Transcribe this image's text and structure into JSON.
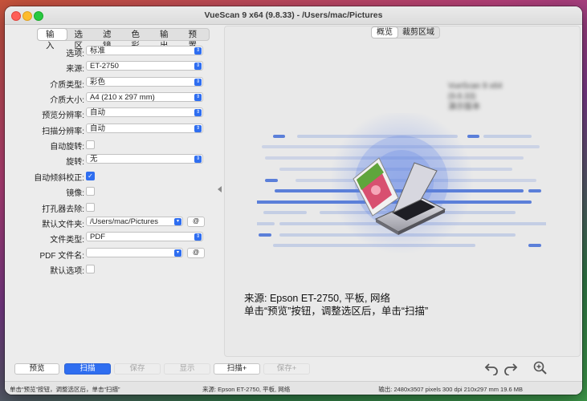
{
  "window": {
    "title": "VueScan 9 x64 (9.8.33) - /Users/mac/Pictures"
  },
  "left_tabs": [
    "输入",
    "选区",
    "滤镜",
    "色彩",
    "输出",
    "预置"
  ],
  "form": {
    "option": {
      "label": "选项:",
      "value": "标准"
    },
    "source": {
      "label": "来源:",
      "value": "ET-2750"
    },
    "media_type": {
      "label": "介质类型:",
      "value": "彩色"
    },
    "media_size": {
      "label": "介质大小:",
      "value": "A4 (210 x 297 mm)"
    },
    "preview_res": {
      "label": "预览分辨率:",
      "value": "自动"
    },
    "scan_res": {
      "label": "扫描分辨率:",
      "value": "自动"
    },
    "auto_rotate": {
      "label": "自动旋转:"
    },
    "rotate": {
      "label": "旋转:",
      "value": "无"
    },
    "auto_deskew": {
      "label": "自动倾斜校正:"
    },
    "mirror": {
      "label": "镜像:"
    },
    "hole_remove": {
      "label": "打孔器去除:"
    },
    "default_folder": {
      "label": "默认文件夹:",
      "value": "/Users/mac/Pictures",
      "at": "@"
    },
    "file_type": {
      "label": "文件类型:",
      "value": "PDF"
    },
    "pdf_name": {
      "label": "PDF 文件名:",
      "value": "",
      "at": "@"
    },
    "default_opts": {
      "label": "默认选项:"
    }
  },
  "right_tabs": [
    "概览",
    "裁剪区域"
  ],
  "overview": {
    "blurred_line1": "VueScan 9 x64 (9.8.33)",
    "blurred_line2": "演示版本",
    "source_info": "来源: Epson ET-2750, 平板, 网络",
    "hint": "单击“预览”按钮，调整选区后，单击“扫描”"
  },
  "buttons": {
    "preview": "预览",
    "scan": "扫描",
    "save": "保存",
    "show": "显示",
    "scan_plus": "扫描+",
    "save_plus": "保存+"
  },
  "status": {
    "left": "单击“预览”按钮，调整选区后，单击“扫描”",
    "center": "来源: Epson ET-2750, 平板, 网络",
    "right": "输出: 2480x3507 pixels 300 dpi 210x297 mm 19.6 MB"
  },
  "colors": {
    "accent": "#2f6ef0",
    "scan_lines": "#5b7fd9"
  },
  "icons": [
    "undo-icon",
    "redo-icon",
    "zoom-in-icon",
    "scanner-icon"
  ]
}
